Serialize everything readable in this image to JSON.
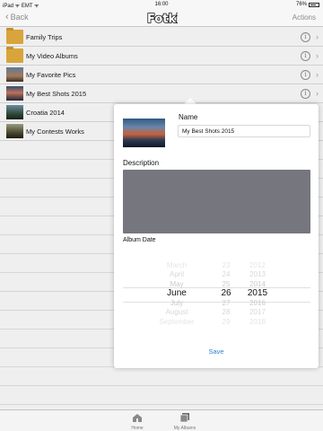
{
  "status": {
    "carrier": "iPad ᯤ EMT ᯤ",
    "time": "16:00",
    "battery": "76%"
  },
  "nav": {
    "back_label": "Back",
    "actions_label": "Actions",
    "logo_text": "Fotki"
  },
  "albums": [
    {
      "label": "Family Trips",
      "thumb": "folder"
    },
    {
      "label": "My Video Albums",
      "thumb": "folder"
    },
    {
      "label": "My Favorite Pics",
      "thumb": "photo1"
    },
    {
      "label": "My Best Shots 2015",
      "thumb": "photo2"
    },
    {
      "label": "Croatia 2014",
      "thumb": "photo3"
    },
    {
      "label": "My Contests Works",
      "thumb": "photo4"
    }
  ],
  "popover": {
    "name_label": "Name",
    "name_value": "My Best Shots 2015",
    "description_label": "Description",
    "album_date_label": "Album Date",
    "save_label": "Save",
    "picker": {
      "months": [
        "March",
        "April",
        "May",
        "June",
        "July",
        "August",
        "September"
      ],
      "days": [
        "23",
        "24",
        "25",
        "26",
        "27",
        "28",
        "29"
      ],
      "years": [
        "2012",
        "2013",
        "2014",
        "2015",
        "2016",
        "2017",
        "2018"
      ],
      "selected_index": 3
    }
  },
  "tabs": {
    "home_label": "Home",
    "albums_label": "My Albums"
  },
  "colors": {
    "accent": "#2b82d6",
    "description_box": "#76767e",
    "folder": "#d9a43b"
  }
}
